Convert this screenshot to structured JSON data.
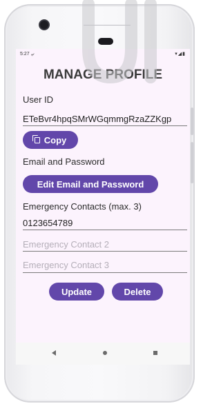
{
  "status_bar": {
    "time": "5:27",
    "notification_icon": "missed-call-icon",
    "right_icons": "▾◢▮"
  },
  "page": {
    "title": "MANAGE PROFILE"
  },
  "user_id": {
    "label": "User ID",
    "value": "ETeBvr4hpqSMrWGqmmgRzaZZKgp"
  },
  "copy_button": {
    "label": "Copy",
    "icon": "copy-icon"
  },
  "email_password": {
    "label": "Email and Password",
    "button_label": "Edit Email and Password"
  },
  "emergency": {
    "label": "Emergency Contacts (max. 3)",
    "contact_1_value": "0123654789",
    "contact_2_placeholder": "Emergency Contact 2",
    "contact_3_placeholder": "Emergency Contact 3"
  },
  "actions": {
    "update_label": "Update",
    "delete_label": "Delete"
  },
  "colors": {
    "accent": "#6247aa",
    "screen_background": "#fcf3fd"
  }
}
